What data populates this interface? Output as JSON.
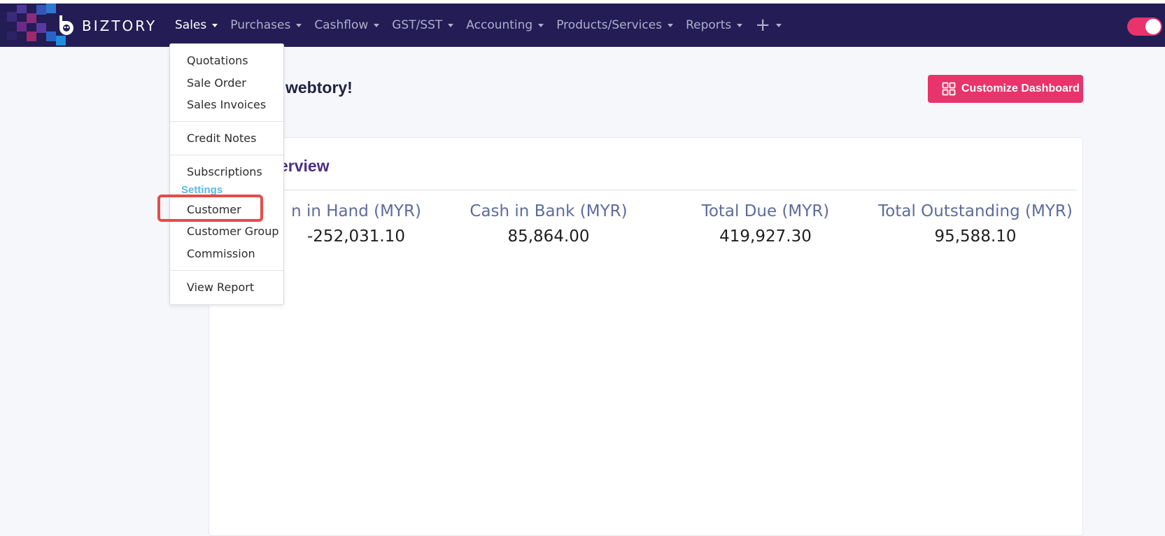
{
  "brand": {
    "name": "BIZTORY",
    "accent": "#e8336b",
    "navbar_bg": "#231c55"
  },
  "nav": {
    "items": [
      {
        "label": "Sales",
        "active": true
      },
      {
        "label": "Purchases"
      },
      {
        "label": "Cashflow"
      },
      {
        "label": "GST/SST"
      },
      {
        "label": "Accounting"
      },
      {
        "label": "Products/Services"
      },
      {
        "label": "Reports"
      }
    ],
    "add_icon": "plus-icon"
  },
  "dashboard": {
    "welcome": "webtory!",
    "customize_label": "Customize Dashboard",
    "overview_title": "erview",
    "stats": [
      {
        "label": "n in Hand (MYR)",
        "value": "-252,031.10"
      },
      {
        "label": "Cash in Bank (MYR)",
        "value": "85,864.00"
      },
      {
        "label": "Total Due (MYR)",
        "value": "419,927.30"
      },
      {
        "label": "Total Outstanding (MYR)",
        "value": "95,588.10"
      }
    ]
  },
  "sales_menu": {
    "quotations": "Quotations",
    "sale_order": "Sale Order",
    "sales_invoices": "Sales Invoices",
    "credit_notes": "Credit Notes",
    "subscriptions": "Subscriptions",
    "settings_header": "Settings",
    "customer": "Customer",
    "customer_group": "Customer Group",
    "commission": "Commission",
    "view_report": "View Report"
  }
}
